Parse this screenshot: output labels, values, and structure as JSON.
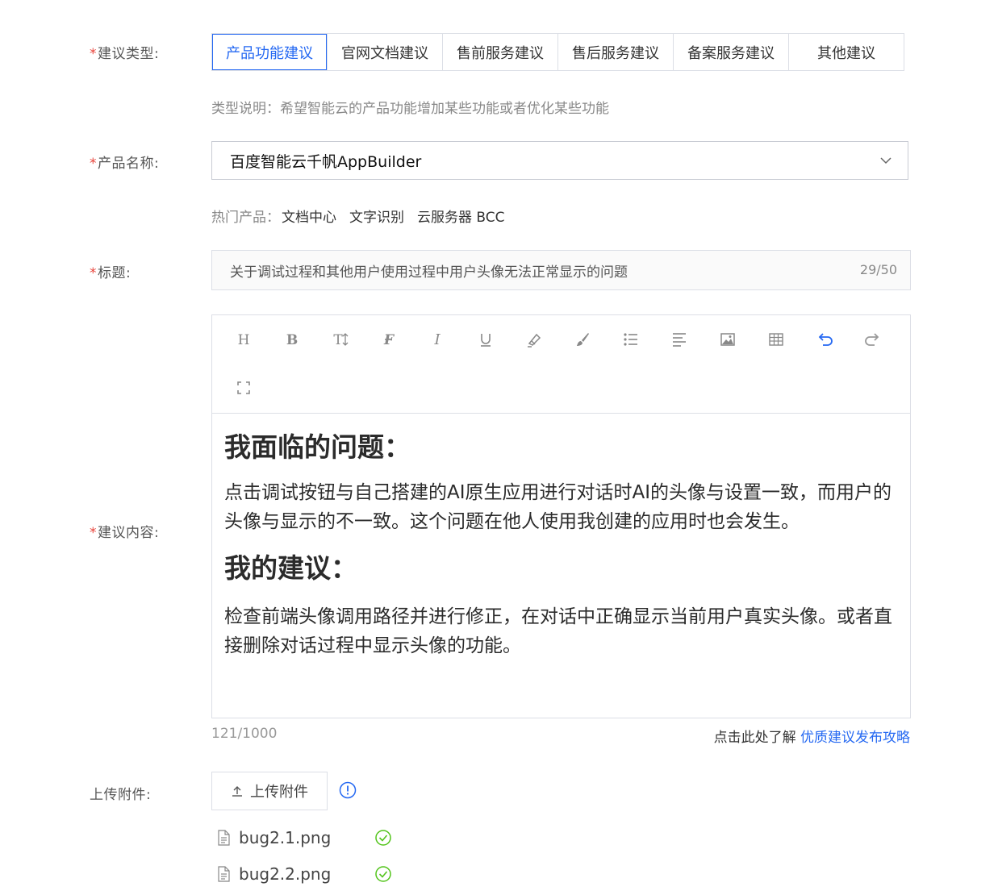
{
  "form": {
    "type_label": "建议类型:",
    "type_options": [
      "产品功能建议",
      "官网文档建议",
      "售前服务建议",
      "售后服务建议",
      "备案服务建议",
      "其他建议"
    ],
    "type_selected": "产品功能建议",
    "type_hint": "类型说明：希望智能云的产品功能增加某些功能或者优化某些功能",
    "product_label": "产品名称:",
    "product_value": "百度智能云千帆AppBuilder",
    "hot_label": "热门产品：",
    "hot_products": [
      "文档中心",
      "文字识别",
      "云服务器 BCC"
    ],
    "title_label": "标题:",
    "title_value": "关于调试过程和其他用户使用过程中用户头像无法正常显示的问题",
    "title_count": "29/50",
    "content_label": "建议内容:",
    "content_count": "121/1000",
    "guide_prefix": "点击此处了解",
    "guide_link": "优质建议发布攻略",
    "upload_label": "上传附件:",
    "upload_button": "上传附件"
  },
  "editor": {
    "toolbar_icons": [
      "heading-icon",
      "bold-icon",
      "text-size-icon",
      "font-icon",
      "italic-icon",
      "underline-icon",
      "highlight-icon",
      "brush-icon",
      "list-icon",
      "align-icon",
      "image-icon",
      "table-icon",
      "undo-icon",
      "redo-icon",
      "fullscreen-icon"
    ],
    "heading1": "我面临的问题：",
    "para1": "点击调试按钮与自己搭建的AI原生应用进行对话时AI的头像与设置一致，而用户的头像与显示的不一致。这个问题在他人使用我创建的应用时也会发生。",
    "heading2": "我的建议：",
    "para2": "检查前端头像调用路径并进行修正，在对话中正确显示当前用户真实头像。或者直接删除对话过程中显示头像的功能。"
  },
  "files": [
    {
      "name": "bug2.1.png",
      "status": "success"
    },
    {
      "name": "bug2.2.png",
      "status": "success"
    }
  ],
  "colors": {
    "accent": "#2468f2",
    "required": "#e8433a",
    "success": "#52c41a"
  }
}
